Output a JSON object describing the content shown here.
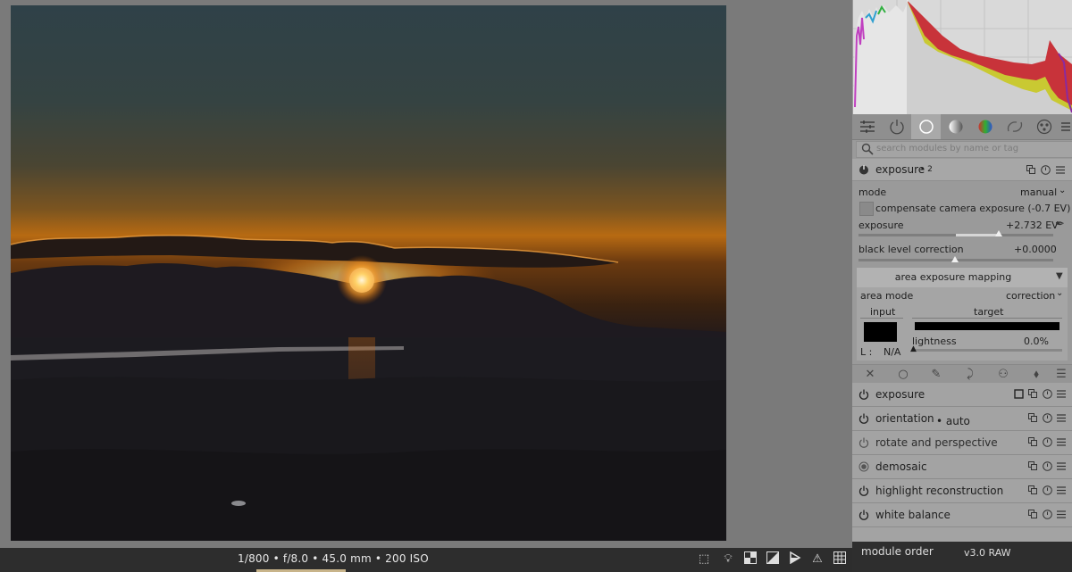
{
  "image": {
    "description": "sunset-photo"
  },
  "bottom_bar": {
    "exif": "1/800 • f/8.0 • 45.0 mm • 200 ISO"
  },
  "right_panel": {
    "search_placeholder": "search modules by name or tag",
    "module": {
      "name": "exposure",
      "instance": "• 2",
      "mode_label": "mode",
      "mode_value": "manual",
      "compensate_label": "compensate camera exposure (-0.7 EV)",
      "exposure_label": "exposure",
      "exposure_value": "+2.732 EV",
      "exposure_slider": 0.72,
      "black_label": "black level correction",
      "black_value": "+0.0000",
      "aem": {
        "title": "area exposure mapping",
        "area_mode_label": "area mode",
        "area_mode_value": "correction",
        "input_label": "input",
        "target_label": "target",
        "lightness_label": "lightness",
        "lightness_value": "0.0%",
        "l_label": "L :",
        "l_value": "N/A"
      }
    },
    "modules": [
      {
        "name": "exposure",
        "suffix": ""
      },
      {
        "name": "orientation",
        "suffix": "• auto"
      },
      {
        "name": "rotate and perspective",
        "suffix": ""
      },
      {
        "name": "demosaic",
        "suffix": ""
      },
      {
        "name": "highlight reconstruction",
        "suffix": ""
      },
      {
        "name": "white balance",
        "suffix": ""
      }
    ],
    "module_order_label": "module order",
    "module_order_value": "v3.0 RAW"
  },
  "colors": {
    "panel_bg": "#9a9a9a",
    "bottom_bar_bg": "#2d2d2d",
    "accent_fill": "#d6d6d6"
  }
}
